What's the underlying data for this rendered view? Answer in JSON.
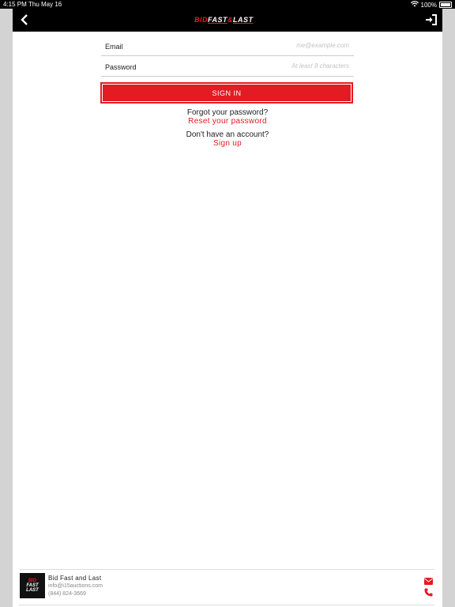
{
  "status_bar": {
    "time": "4:15 PM",
    "date": "Thu May 16",
    "battery": "100%"
  },
  "navbar": {
    "logo_part1": "BID",
    "logo_part2": "FAST",
    "logo_part3": "&",
    "logo_part4": "LAST"
  },
  "form": {
    "email_label": "Email",
    "email_placeholder": "me@example.com",
    "password_label": "Password",
    "password_placeholder": "At least 8 characters",
    "signin_label": "SIGN IN"
  },
  "links": {
    "forgot_question": "Forgot your password?",
    "reset_link": "Reset your password",
    "account_question": "Don't have an account?",
    "signup_link": "Sign up"
  },
  "footer": {
    "company": "Bid Fast and Last",
    "email": "info@i15auctions.com",
    "phone": "(844) 824-3669",
    "logo_line1": "BID",
    "logo_line2": "FAST",
    "logo_line3": "LAST"
  },
  "colors": {
    "accent": "#e31b23",
    "navbar": "#000000",
    "background": "#ffffff"
  }
}
